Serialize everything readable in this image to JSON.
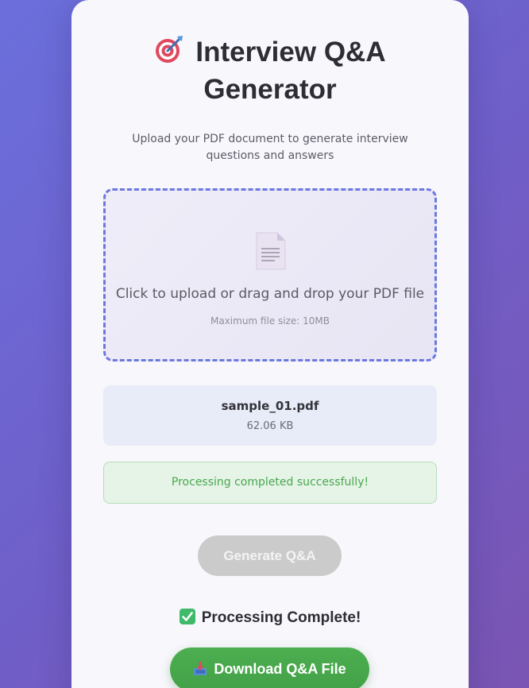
{
  "header": {
    "title_line1": "Interview Q&A",
    "title_line2": "Generator",
    "icon": "target-icon"
  },
  "subtitle": "Upload your PDF document to generate interview questions and answers",
  "upload": {
    "icon": "document-icon",
    "prompt": "Click to upload or drag and drop your PDF file",
    "hint": "Maximum file size: 10MB"
  },
  "file": {
    "name": "sample_01.pdf",
    "size": "62.06 KB"
  },
  "status": {
    "message": "Processing completed successfully!"
  },
  "actions": {
    "generate_label": "Generate Q&A",
    "generate_disabled": true,
    "complete_label": "Processing Complete!",
    "complete_icon": "checkmark-icon",
    "download_label": "Download Q&A File",
    "download_icon": "download-icon"
  },
  "colors": {
    "accent": "#6b78e0",
    "success": "#48a84e",
    "download_button": "#4caf50",
    "disabled_button": "#cbcbcb"
  }
}
